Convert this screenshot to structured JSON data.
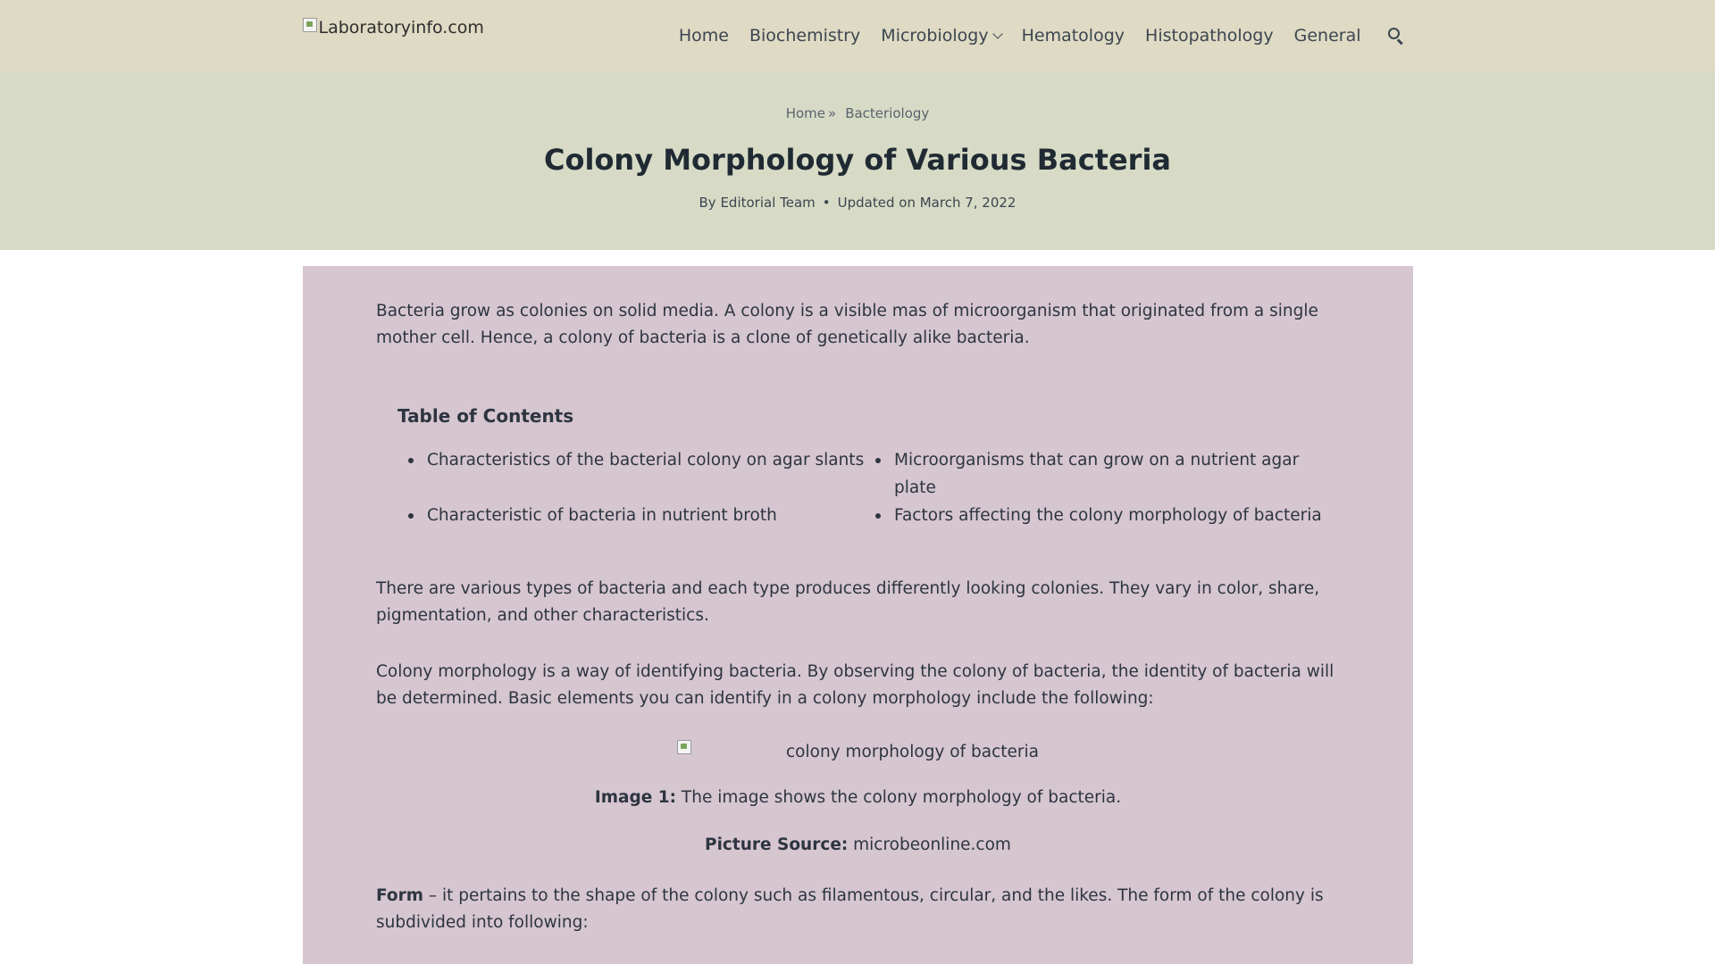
{
  "header": {
    "logo_text": "Laboratoryinfo.com",
    "nav": [
      "Home",
      "Biochemistry",
      "Microbiology",
      "Hematology",
      "Histopathology",
      "General"
    ]
  },
  "hero": {
    "breadcrumb_home": "Home",
    "breadcrumb_sep": "»",
    "breadcrumb_current": "Bacteriology",
    "title": "Colony Morphology of Various Bacteria",
    "author": "By Editorial Team",
    "meta_dot": "•",
    "updated": "Updated on March 7, 2022"
  },
  "content": {
    "intro": "Bacteria grow as colonies on solid media. A colony is a visible mas of microorganism that originated from a single mother cell. Hence, a colony of bacteria is a clone of genetically alike bacteria.",
    "toc_title": "Table of Contents",
    "toc_items": [
      "Characteristics of the bacterial colony on agar slants",
      "Microorganisms that can grow on a nutrient agar plate",
      "Characteristic of bacteria in nutrient broth",
      "Factors affecting the colony morphology of bacteria"
    ],
    "para2": "There are various types of bacteria and each type produces differently looking colonies. They vary in color, share, pigmentation, and other characteristics.",
    "para3": "Colony morphology is a way of identifying bacteria. By observing the colony of bacteria, the identity of bacteria will be determined. Basic elements you can identify in a colony morphology include the following:",
    "image_alt": "colony morphology of bacteria",
    "caption_label": "Image 1:",
    "caption_text": " The image shows the colony morphology of bacteria.",
    "source_label": "Picture Source:",
    "source_text": " microbeonline.com",
    "form_label": "Form",
    "form_text": " – it pertains to the shape of the colony such as filamentous, circular, and the likes. The form of the colony is subdivided into following:"
  }
}
